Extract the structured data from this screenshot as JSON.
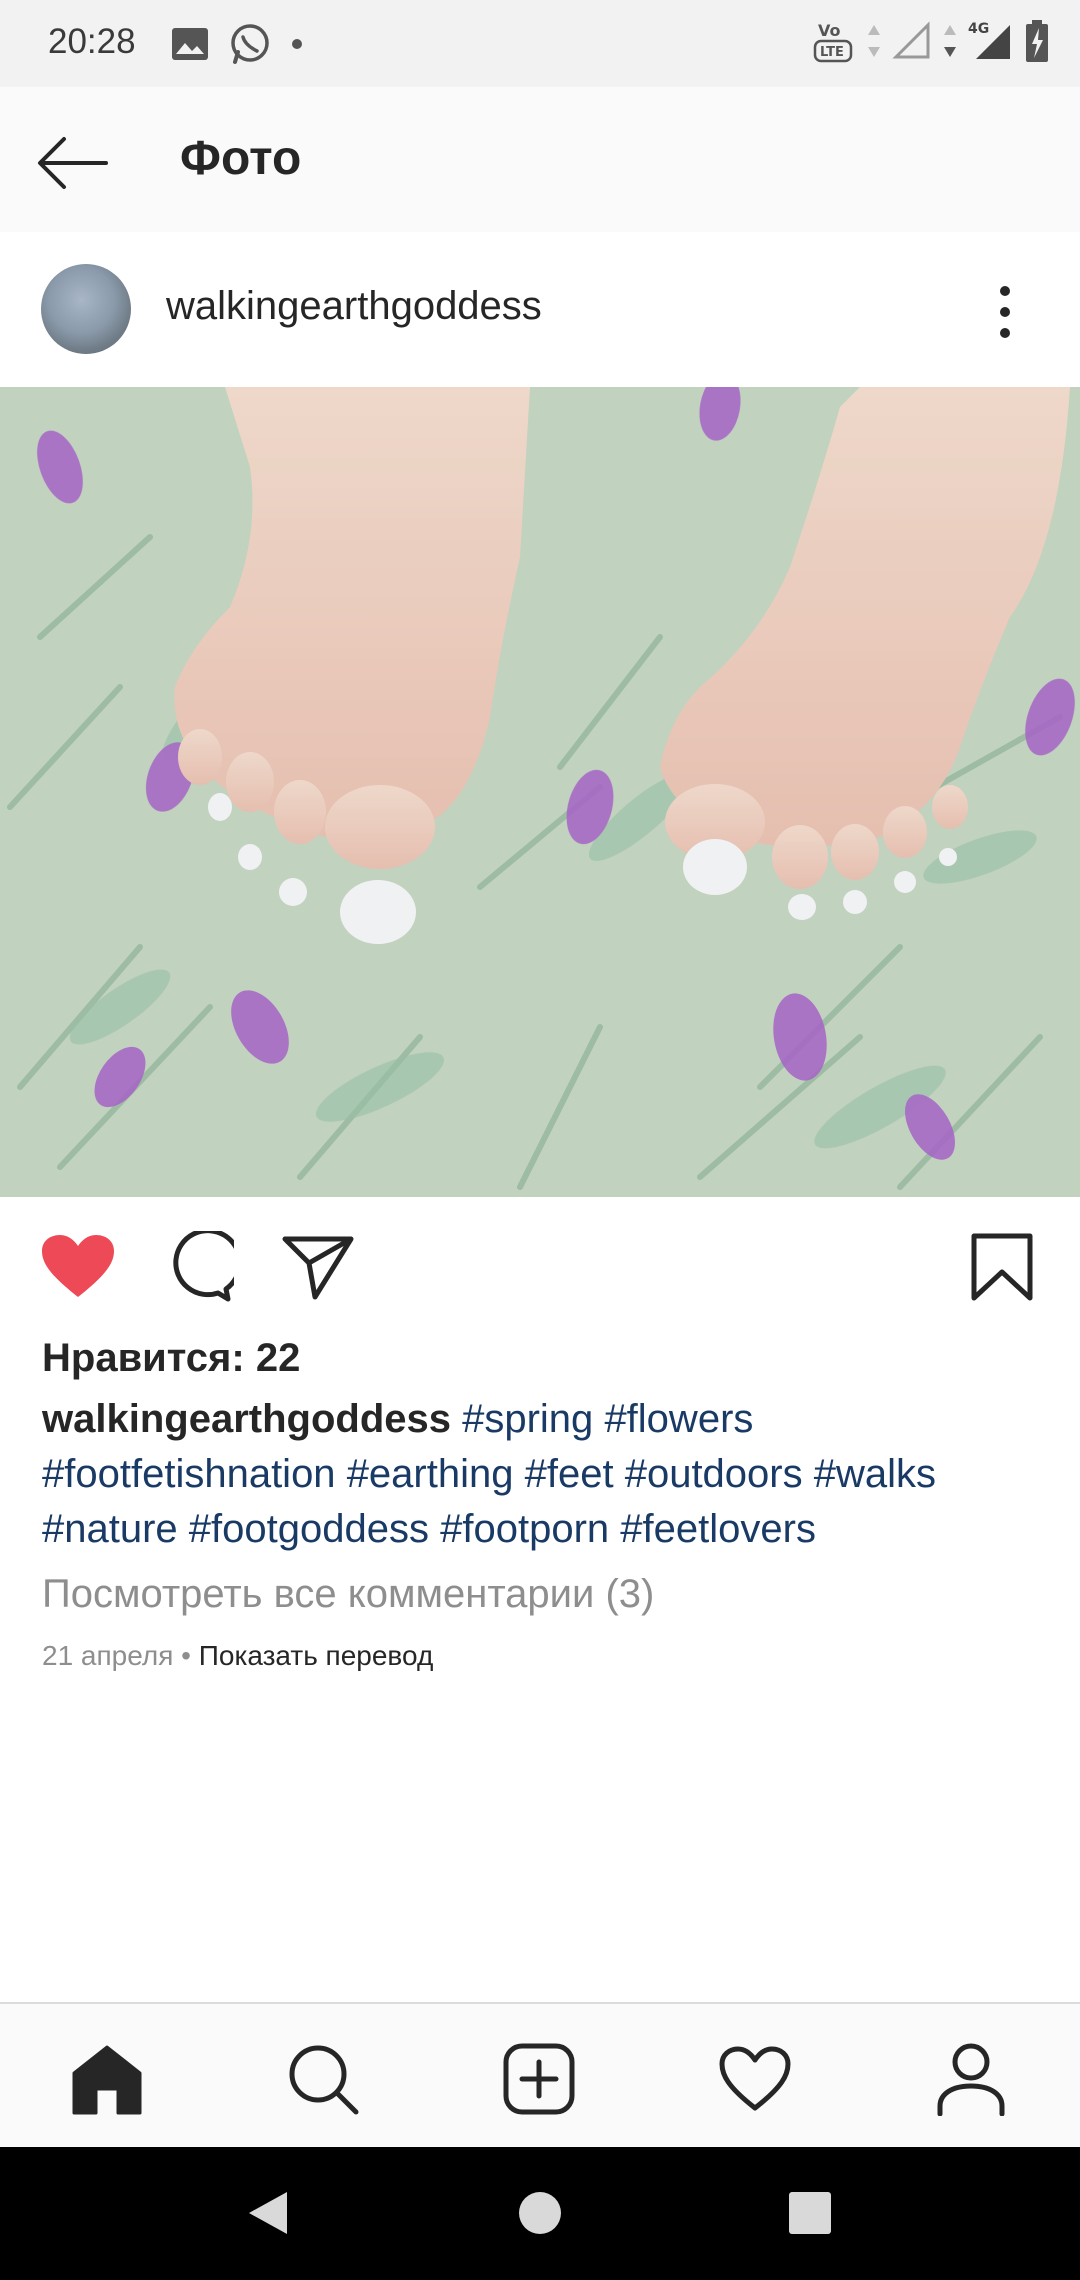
{
  "status_bar": {
    "time": "20:28",
    "left_icons": [
      "image-icon",
      "whatsapp-icon",
      "dot-icon"
    ],
    "right_icons": [
      "volte-icon",
      "wifi-signal-icon",
      "4g-signal-icon",
      "battery-charging-icon"
    ],
    "network_label": "4G",
    "volte_label": "VoLTE"
  },
  "topbar": {
    "title": "Фото"
  },
  "post": {
    "username": "walkingearthgoddess",
    "likes_text": "Нравится: 22",
    "caption": {
      "username": "walkingearthgoddess",
      "hashtags": [
        "#spring",
        "#flowers",
        "#footfetishnation",
        "#earthing",
        "#feet",
        "#outdoors",
        "#walks",
        "#nature",
        "#footgoddess",
        "#footporn",
        "#feetlovers"
      ]
    },
    "view_comments": "Посмотреть все комментарии (3)",
    "date": "21 апреля",
    "separator": " • ",
    "translate": "Показать перевод",
    "liked": true
  },
  "colors": {
    "heart": "#ed4956",
    "hashtag": "#1a3a66",
    "secondary_text": "#8e8e8e"
  },
  "bottom_nav": {
    "items": [
      "home-icon",
      "search-icon",
      "add-post-icon",
      "activity-heart-icon",
      "profile-icon"
    ]
  },
  "system_nav": {
    "items": [
      "back-triangle-icon",
      "home-circle-icon",
      "recents-square-icon"
    ]
  }
}
